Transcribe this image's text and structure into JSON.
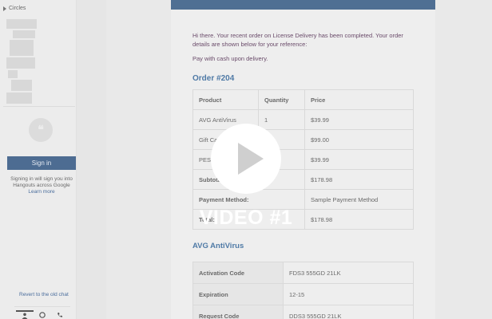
{
  "sidebar": {
    "circles_label": "Circles",
    "sign_in_label": "Sign in",
    "sign_note": "Signing in will sign you into Hangouts across Google",
    "learn_more": "Learn more",
    "revert_link": "Revert to the old chat",
    "tabs": [
      "person-icon",
      "hangouts-icon",
      "phone-icon"
    ]
  },
  "email": {
    "greeting": "Hi there. Your recent order on License Delivery has been completed. Your order details are shown below for your reference:",
    "payment_note": "Pay with cash upon delivery.",
    "order_title": "Order #204",
    "order_headers": [
      "Product",
      "Quantity",
      "Price"
    ],
    "order_rows": [
      [
        "AVG AntiVirus",
        "1",
        "$39.99"
      ],
      [
        "Gift Car",
        "",
        "$99.00"
      ],
      [
        "PES 2016",
        "",
        "$39.99"
      ]
    ],
    "summary": [
      [
        "Subtotal:",
        "$178.98"
      ],
      [
        "Payment Method:",
        "Sample Payment Method"
      ],
      [
        "Total:",
        "$178.98"
      ]
    ],
    "product_title": "AVG AntiVirus",
    "codes": [
      [
        "Activation Code",
        "FDS3 555GD 21LK"
      ],
      [
        "Expiration",
        "12-15"
      ],
      [
        "Request Code",
        "DDS3 555GD 21LK"
      ]
    ]
  },
  "overlay": {
    "video_label": "VIDEO #1"
  },
  "colors": {
    "header_blue": "#4f6f93",
    "link_blue": "#4f7aa6"
  }
}
